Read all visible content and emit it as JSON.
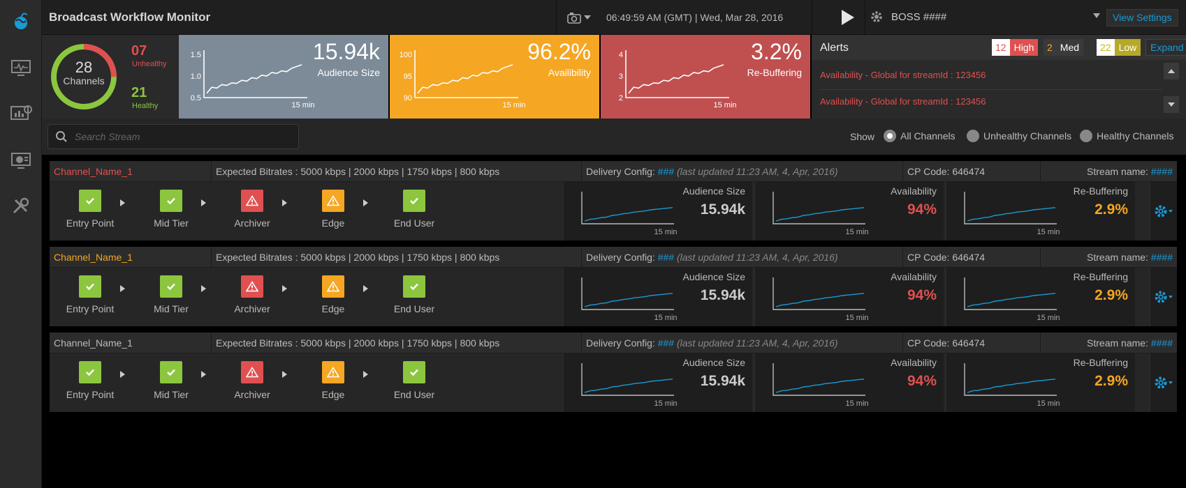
{
  "header": {
    "title": "Broadcast Workflow Monitor",
    "clock": "06:49:59 AM (GMT) | Wed, Mar 28, 2016",
    "profile": "BOSS ####",
    "view_settings": "View Settings"
  },
  "nav": {
    "icons": [
      "globe-icon",
      "monitor-icon",
      "analytics-icon",
      "dashboard-icon",
      "tools-icon"
    ]
  },
  "summary": {
    "channels": {
      "total": "28",
      "label": "Channels",
      "unhealthy_count": "07",
      "unhealthy_label": "Unhealthy",
      "healthy_count": "21",
      "healthy_label": "Healthy"
    },
    "kpis": [
      {
        "value": "15.94k",
        "label": "Audience Size",
        "bg": "#7d8b99",
        "y_ticks": [
          "1.5",
          "1.0",
          "0.5"
        ],
        "x_label": "15 min",
        "trend": [
          0.1,
          0.24,
          0.22,
          0.3,
          0.28,
          0.34,
          0.33,
          0.4,
          0.38,
          0.46,
          0.44,
          0.52,
          0.5,
          0.58,
          0.56,
          0.62,
          0.6,
          0.68,
          0.72,
          0.76
        ]
      },
      {
        "value": "96.2%",
        "label": "Availibility",
        "bg": "#f5a623",
        "y_ticks": [
          "100",
          "95",
          "90"
        ],
        "x_label": "15 min",
        "trend": [
          0.1,
          0.24,
          0.22,
          0.3,
          0.28,
          0.34,
          0.33,
          0.4,
          0.38,
          0.46,
          0.44,
          0.52,
          0.5,
          0.58,
          0.56,
          0.62,
          0.6,
          0.68,
          0.72,
          0.76
        ]
      },
      {
        "value": "3.2%",
        "label": "Re-Buffering",
        "bg": "#c05050",
        "y_ticks": [
          "4",
          "3",
          "2"
        ],
        "x_label": "15 min",
        "trend": [
          0.1,
          0.24,
          0.22,
          0.3,
          0.28,
          0.34,
          0.33,
          0.4,
          0.38,
          0.46,
          0.44,
          0.52,
          0.5,
          0.58,
          0.56,
          0.62,
          0.6,
          0.68,
          0.72,
          0.76
        ]
      }
    ],
    "healthy_ratio": 0.75
  },
  "alerts": {
    "title": "Alerts",
    "high": {
      "count": "12",
      "label": "High"
    },
    "med": {
      "count": "2",
      "label": "Med"
    },
    "low": {
      "count": "22",
      "label": "Low"
    },
    "expand": "Expand Alerts",
    "items": [
      "Availability - Global for streamId : 123456",
      "Availability - Global for streamId : 123456"
    ]
  },
  "filter": {
    "search_placeholder": "Search Stream",
    "show_label": "Show",
    "options": [
      "All Channels",
      "Unhealthy Channels",
      "Healthy Channels"
    ],
    "selected": 0
  },
  "channels": [
    {
      "name": "Channel_Name_1",
      "name_color": "#e05050",
      "bitrates": "Expected Bitrates : 5000 kbps  |  2000 kbps  |  1750 kbps  |  800 kbps",
      "delivery_prefix": "Delivery Config: ",
      "delivery_hash": "###",
      "delivery_updated": " (last updated 11:23 AM, 4, Apr, 2016)",
      "cp_code": "CP Code: 646474",
      "stream_prefix": "Stream name: ",
      "stream_hash": "####",
      "stages": [
        {
          "label": "Entry Point",
          "status": "ok"
        },
        {
          "label": "Mid Tier",
          "status": "ok"
        },
        {
          "label": "Archiver",
          "status": "error"
        },
        {
          "label": "Edge",
          "status": "warning"
        },
        {
          "label": "End User",
          "status": "ok"
        }
      ],
      "metrics": [
        {
          "label": "Audience Size",
          "value": "15.94k",
          "color": "#cccccc",
          "x_label": "15 min"
        },
        {
          "label": "Availability",
          "value": "94%",
          "color": "#e05050",
          "x_label": "15 min"
        },
        {
          "label": "Re-Buffering",
          "value": "2.9%",
          "color": "#f5a623",
          "x_label": "15 min"
        }
      ]
    },
    {
      "name": "Channel_Name_1",
      "name_color": "#f5a623",
      "bitrates": "Expected Bitrates : 5000 kbps  |  2000 kbps  |  1750 kbps  |  800 kbps",
      "delivery_prefix": "Delivery Config: ",
      "delivery_hash": "###",
      "delivery_updated": " (last updated 11:23 AM, 4, Apr, 2016)",
      "cp_code": "CP Code: 646474",
      "stream_prefix": "Stream name: ",
      "stream_hash": "####",
      "stages": [
        {
          "label": "Entry Point",
          "status": "ok"
        },
        {
          "label": "Mid Tier",
          "status": "ok"
        },
        {
          "label": "Archiver",
          "status": "error"
        },
        {
          "label": "Edge",
          "status": "warning"
        },
        {
          "label": "End User",
          "status": "ok"
        }
      ],
      "metrics": [
        {
          "label": "Audience Size",
          "value": "15.94k",
          "color": "#cccccc",
          "x_label": "15 min"
        },
        {
          "label": "Availability",
          "value": "94%",
          "color": "#e05050",
          "x_label": "15 min"
        },
        {
          "label": "Re-Buffering",
          "value": "2.9%",
          "color": "#f5a623",
          "x_label": "15 min"
        }
      ]
    },
    {
      "name": "Channel_Name_1",
      "name_color": "#bbbbbb",
      "bitrates": "Expected Bitrates : 5000 kbps  |  2000 kbps  |  1750 kbps  |  800 kbps",
      "delivery_prefix": "Delivery Config: ",
      "delivery_hash": "###",
      "delivery_updated": " (last updated 11:23 AM, 4, Apr, 2016)",
      "cp_code": "CP Code: 646474",
      "stream_prefix": "Stream name: ",
      "stream_hash": "####",
      "stages": [
        {
          "label": "Entry Point",
          "status": "ok"
        },
        {
          "label": "Mid Tier",
          "status": "ok"
        },
        {
          "label": "Archiver",
          "status": "error"
        },
        {
          "label": "Edge",
          "status": "warning"
        },
        {
          "label": "End User",
          "status": "ok"
        }
      ],
      "metrics": [
        {
          "label": "Audience Size",
          "value": "15.94k",
          "color": "#cccccc",
          "x_label": "15 min"
        },
        {
          "label": "Availability",
          "value": "94%",
          "color": "#e05050",
          "x_label": "15 min"
        },
        {
          "label": "Re-Buffering",
          "value": "2.9%",
          "color": "#f5a623",
          "x_label": "15 min"
        }
      ]
    }
  ],
  "colors": {
    "ok": "#8cc63f",
    "error": "#e05050",
    "warning": "#f5a623",
    "accent": "#1a9ad6"
  }
}
